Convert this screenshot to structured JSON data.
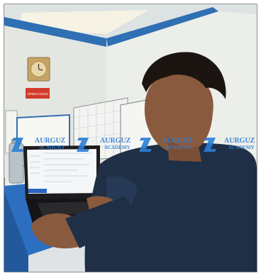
{
  "photo": {
    "subject": "",
    "sign_text": "OPERATIONS",
    "watermark": {
      "line1": "AURGUZ",
      "line2": "ACADEMY",
      "color": "#2b7fd6",
      "repeat": 4
    },
    "colors": {
      "wall": "#e9ebe6",
      "ceiling_trim": "#2f6fb3",
      "desk": "#2c6fc0",
      "shirt": "#1f2f45",
      "skin": "#8a5a3f",
      "hair": "#1b1410",
      "sign": "#d43a2a"
    }
  }
}
